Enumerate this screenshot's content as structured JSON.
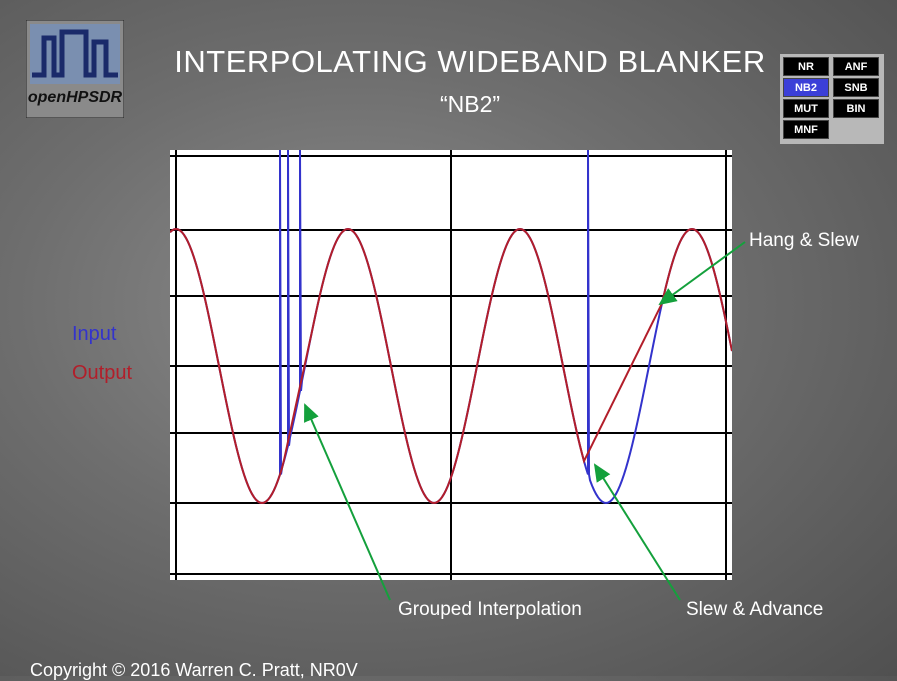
{
  "header": {
    "title": "INTERPOLATING WIDEBAND BLANKER",
    "subtitle": "“NB2”",
    "logo_text": "openHPSDR"
  },
  "mode_buttons": [
    {
      "label": "NR",
      "active": false
    },
    {
      "label": "ANF",
      "active": false
    },
    {
      "label": "NB2",
      "active": true
    },
    {
      "label": "SNB",
      "active": false
    },
    {
      "label": "MUT",
      "active": false
    },
    {
      "label": "BIN",
      "active": false
    },
    {
      "label": "MNF",
      "active": false
    }
  ],
  "legend": {
    "input_label": "Input",
    "output_label": "Output",
    "input_color": "#3333cc",
    "output_color": "#b21e2a"
  },
  "annotations": {
    "hang_slew": "Hang & Slew",
    "grouped_interp": "Grouped Interpolation",
    "slew_advance": "Slew & Advance",
    "arrow_color": "#14a03c"
  },
  "chart_data": {
    "type": "line",
    "title": "",
    "xlabel": "",
    "ylabel": "",
    "grid": true,
    "series": [
      {
        "name": "Input",
        "color": "#3333cc"
      },
      {
        "name": "Output",
        "color": "#b21e2a"
      }
    ]
  },
  "footer": {
    "copyright": "Copyright © 2016 Warren C. Pratt, NR0V"
  }
}
